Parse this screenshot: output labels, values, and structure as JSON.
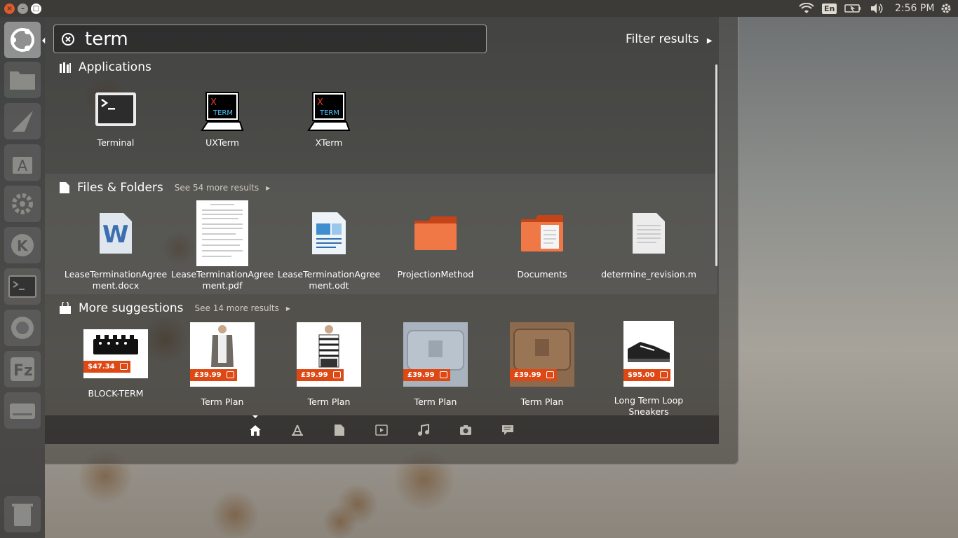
{
  "panel": {
    "keyboard_layout": "En",
    "clock": "2:56 PM"
  },
  "search": {
    "query": "term",
    "filter_label": "Filter results"
  },
  "applications": {
    "title": "Applications",
    "items": [
      {
        "label": "Terminal",
        "icon": "terminal-icon"
      },
      {
        "label": "UXTerm",
        "icon": "uxterm-icon"
      },
      {
        "label": "XTerm",
        "icon": "xterm-icon"
      }
    ]
  },
  "files": {
    "title": "Files & Folders",
    "see_more": "See 54 more results",
    "items": [
      {
        "label": "LeaseTerminationAgreement.docx",
        "icon": "word-document-icon"
      },
      {
        "label": "LeaseTerminationAgreement.pdf",
        "icon": "pdf-document-icon"
      },
      {
        "label": "LeaseTerminationAgreement.odt",
        "icon": "writer-document-icon"
      },
      {
        "label": "ProjectionMethod",
        "icon": "folder-icon"
      },
      {
        "label": "Documents",
        "icon": "documents-folder-icon"
      },
      {
        "label": "determine_revision.m",
        "icon": "text-file-icon"
      }
    ]
  },
  "suggestions": {
    "title": "More suggestions",
    "see_more": "See 14 more results",
    "items": [
      {
        "label": "BLOCK-TERM",
        "price": "$47.34"
      },
      {
        "label": "Term Plan",
        "price": "£39.99"
      },
      {
        "label": "Term Plan",
        "price": "£39.99"
      },
      {
        "label": "Term Plan",
        "price": "£39.99"
      },
      {
        "label": "Term Plan",
        "price": "£39.99"
      },
      {
        "label": "Long Term Loop Sneakers",
        "price": "$95.00"
      }
    ]
  },
  "colors": {
    "accent": "#dd4814",
    "panel": "#3c3b37"
  },
  "lenses": [
    "home-lens-icon",
    "applications-lens-icon",
    "files-lens-icon",
    "video-lens-icon",
    "music-lens-icon",
    "photos-lens-icon",
    "social-lens-icon"
  ]
}
